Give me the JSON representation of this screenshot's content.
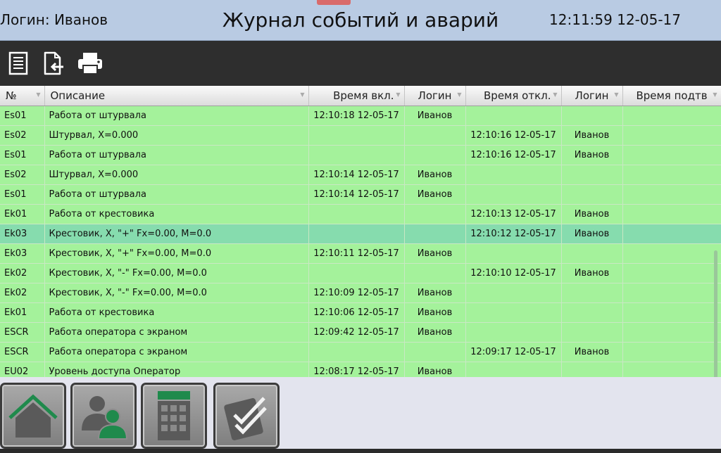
{
  "header": {
    "login": "Логин: Иванов",
    "title": "Журнал событий и аварий",
    "clock": "12:11:59 12-05-17"
  },
  "toolbar": {
    "icons": [
      "document-list-icon",
      "export-icon",
      "printer-icon"
    ]
  },
  "table": {
    "columns": [
      "№",
      "Описание",
      "Время вкл.",
      "Логин",
      "Время откл.",
      "Логин",
      "Время подтв"
    ],
    "rows": [
      [
        "Es01",
        "Работа от штурвала",
        "12:10:18 12-05-17",
        "Иванов",
        "",
        "",
        ""
      ],
      [
        "Es02",
        "Штурвал, X=0.000",
        "",
        "",
        "12:10:16 12-05-17",
        "Иванов",
        ""
      ],
      [
        "Es01",
        "Работа от штурвала",
        "",
        "",
        "12:10:16 12-05-17",
        "Иванов",
        ""
      ],
      [
        "Es02",
        "Штурвал, X=0.000",
        "12:10:14 12-05-17",
        "Иванов",
        "",
        "",
        ""
      ],
      [
        "Es01",
        "Работа от штурвала",
        "12:10:14 12-05-17",
        "Иванов",
        "",
        "",
        ""
      ],
      [
        "Ek01",
        "Работа от крестовика",
        "",
        "",
        "12:10:13 12-05-17",
        "Иванов",
        ""
      ],
      [
        "Ek03",
        "Крестовик, X, \"+\" Fx=0.00, M=0.0",
        "",
        "",
        "12:10:12 12-05-17",
        "Иванов",
        ""
      ],
      [
        "Ek03",
        "Крестовик, X, \"+\" Fx=0.00, M=0.0",
        "12:10:11 12-05-17",
        "Иванов",
        "",
        "",
        ""
      ],
      [
        "Ek02",
        "Крестовик, X, \"-\" Fx=0.00, M=0.0",
        "",
        "",
        "12:10:10 12-05-17",
        "Иванов",
        ""
      ],
      [
        "Ek02",
        "Крестовик, X, \"-\" Fx=0.00, M=0.0",
        "12:10:09 12-05-17",
        "Иванов",
        "",
        "",
        ""
      ],
      [
        "Ek01",
        "Работа от крестовика",
        "12:10:06 12-05-17",
        "Иванов",
        "",
        "",
        ""
      ],
      [
        "ESCR",
        "Работа оператора с экраном",
        "12:09:42 12-05-17",
        "Иванов",
        "",
        "",
        ""
      ],
      [
        "ESCR",
        "Работа оператора с экраном",
        "",
        "",
        "12:09:17 12-05-17",
        "Иванов",
        ""
      ],
      [
        "EU02",
        "Уровень доступа Оператор",
        "12:08:17 12-05-17",
        "Иванов",
        "",
        "",
        ""
      ]
    ],
    "selected_row": 6
  },
  "nav": {
    "buttons": [
      "home-icon",
      "users-icon",
      "calculator-icon",
      "checklist-icon"
    ]
  },
  "colors": {
    "row_bg": "#a4f29b",
    "selected_row_bg": "#86dcae",
    "header_bg": "#b9cbe3",
    "toolbar_bg": "#2e2e2e",
    "accent_green": "#1f8a4c"
  }
}
